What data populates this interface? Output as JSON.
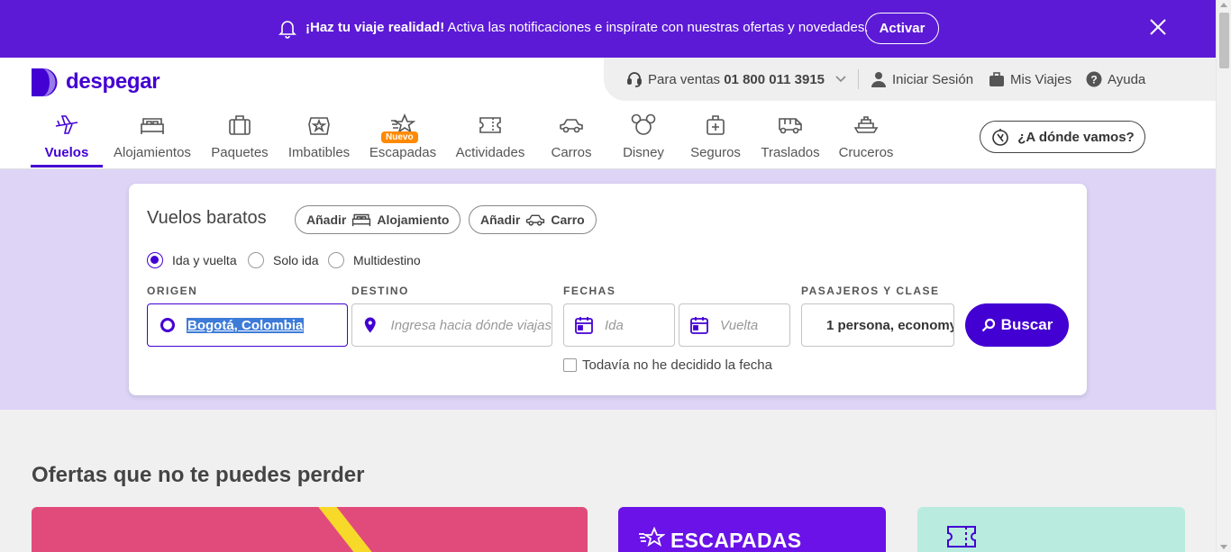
{
  "notification": {
    "bold_text": "¡Haz tu viaje realidad!",
    "text": " Activa las notificaciones e inspírate con nuestras ofertas y novedades.",
    "button_label": "Activar",
    "bg_color": "#5c1ad6"
  },
  "brand": {
    "name": "despegar",
    "color": "#4300d2"
  },
  "topbar": {
    "sales_label": "Para ventas ",
    "sales_phone": "01 800 011 3915",
    "login_label": "Iniciar Sesión",
    "trips_label": "Mis Viajes",
    "help_label": "Ayuda"
  },
  "nav": {
    "tabs": [
      {
        "label": "Vuelos",
        "icon": "plane-icon",
        "active": true
      },
      {
        "label": "Alojamientos",
        "icon": "bed-icon"
      },
      {
        "label": "Paquetes",
        "icon": "suitcase-icon"
      },
      {
        "label": "Imbatibles",
        "icon": "gift-icon"
      },
      {
        "label": "Escapadas",
        "icon": "star-icon",
        "badge": "Nuevo"
      },
      {
        "label": "Actividades",
        "icon": "ticket-icon"
      },
      {
        "label": "Carros",
        "icon": "car-icon"
      },
      {
        "label": "Disney",
        "icon": "mickey-icon"
      },
      {
        "label": "Seguros",
        "icon": "medical-kit-icon"
      },
      {
        "label": "Traslados",
        "icon": "van-icon"
      },
      {
        "label": "Cruceros",
        "icon": "ship-icon"
      }
    ],
    "where_button": "¿A dónde vamos?"
  },
  "search": {
    "title": "Vuelos baratos",
    "add_label": "Añadir",
    "add_lodging": "Alojamiento",
    "add_car": "Carro",
    "trip_types": [
      "Ida y vuelta",
      "Solo ida",
      "Multidestino"
    ],
    "selected_trip_type": "Ida y vuelta",
    "labels": {
      "origin": "ORIGEN",
      "destination": "DESTINO",
      "dates": "FECHAS",
      "passengers": "PASAJEROS Y CLASE"
    },
    "origin_value": "Bogotá, Colombia",
    "destination_placeholder": "Ingresa hacia dónde viajas",
    "departure_placeholder": "Ida",
    "return_placeholder": "Vuelta",
    "passengers_value": "1 persona, economy",
    "search_button": "Buscar",
    "undecided_label": "Todavía no he decidido la fecha"
  },
  "offers": {
    "title": "Ofertas que no te puedes perder",
    "cards": [
      {
        "color": "#e14b7b"
      },
      {
        "color": "#6a12e8",
        "text": "ESCAPADAS"
      },
      {
        "color": "#b9ecdf"
      }
    ]
  }
}
